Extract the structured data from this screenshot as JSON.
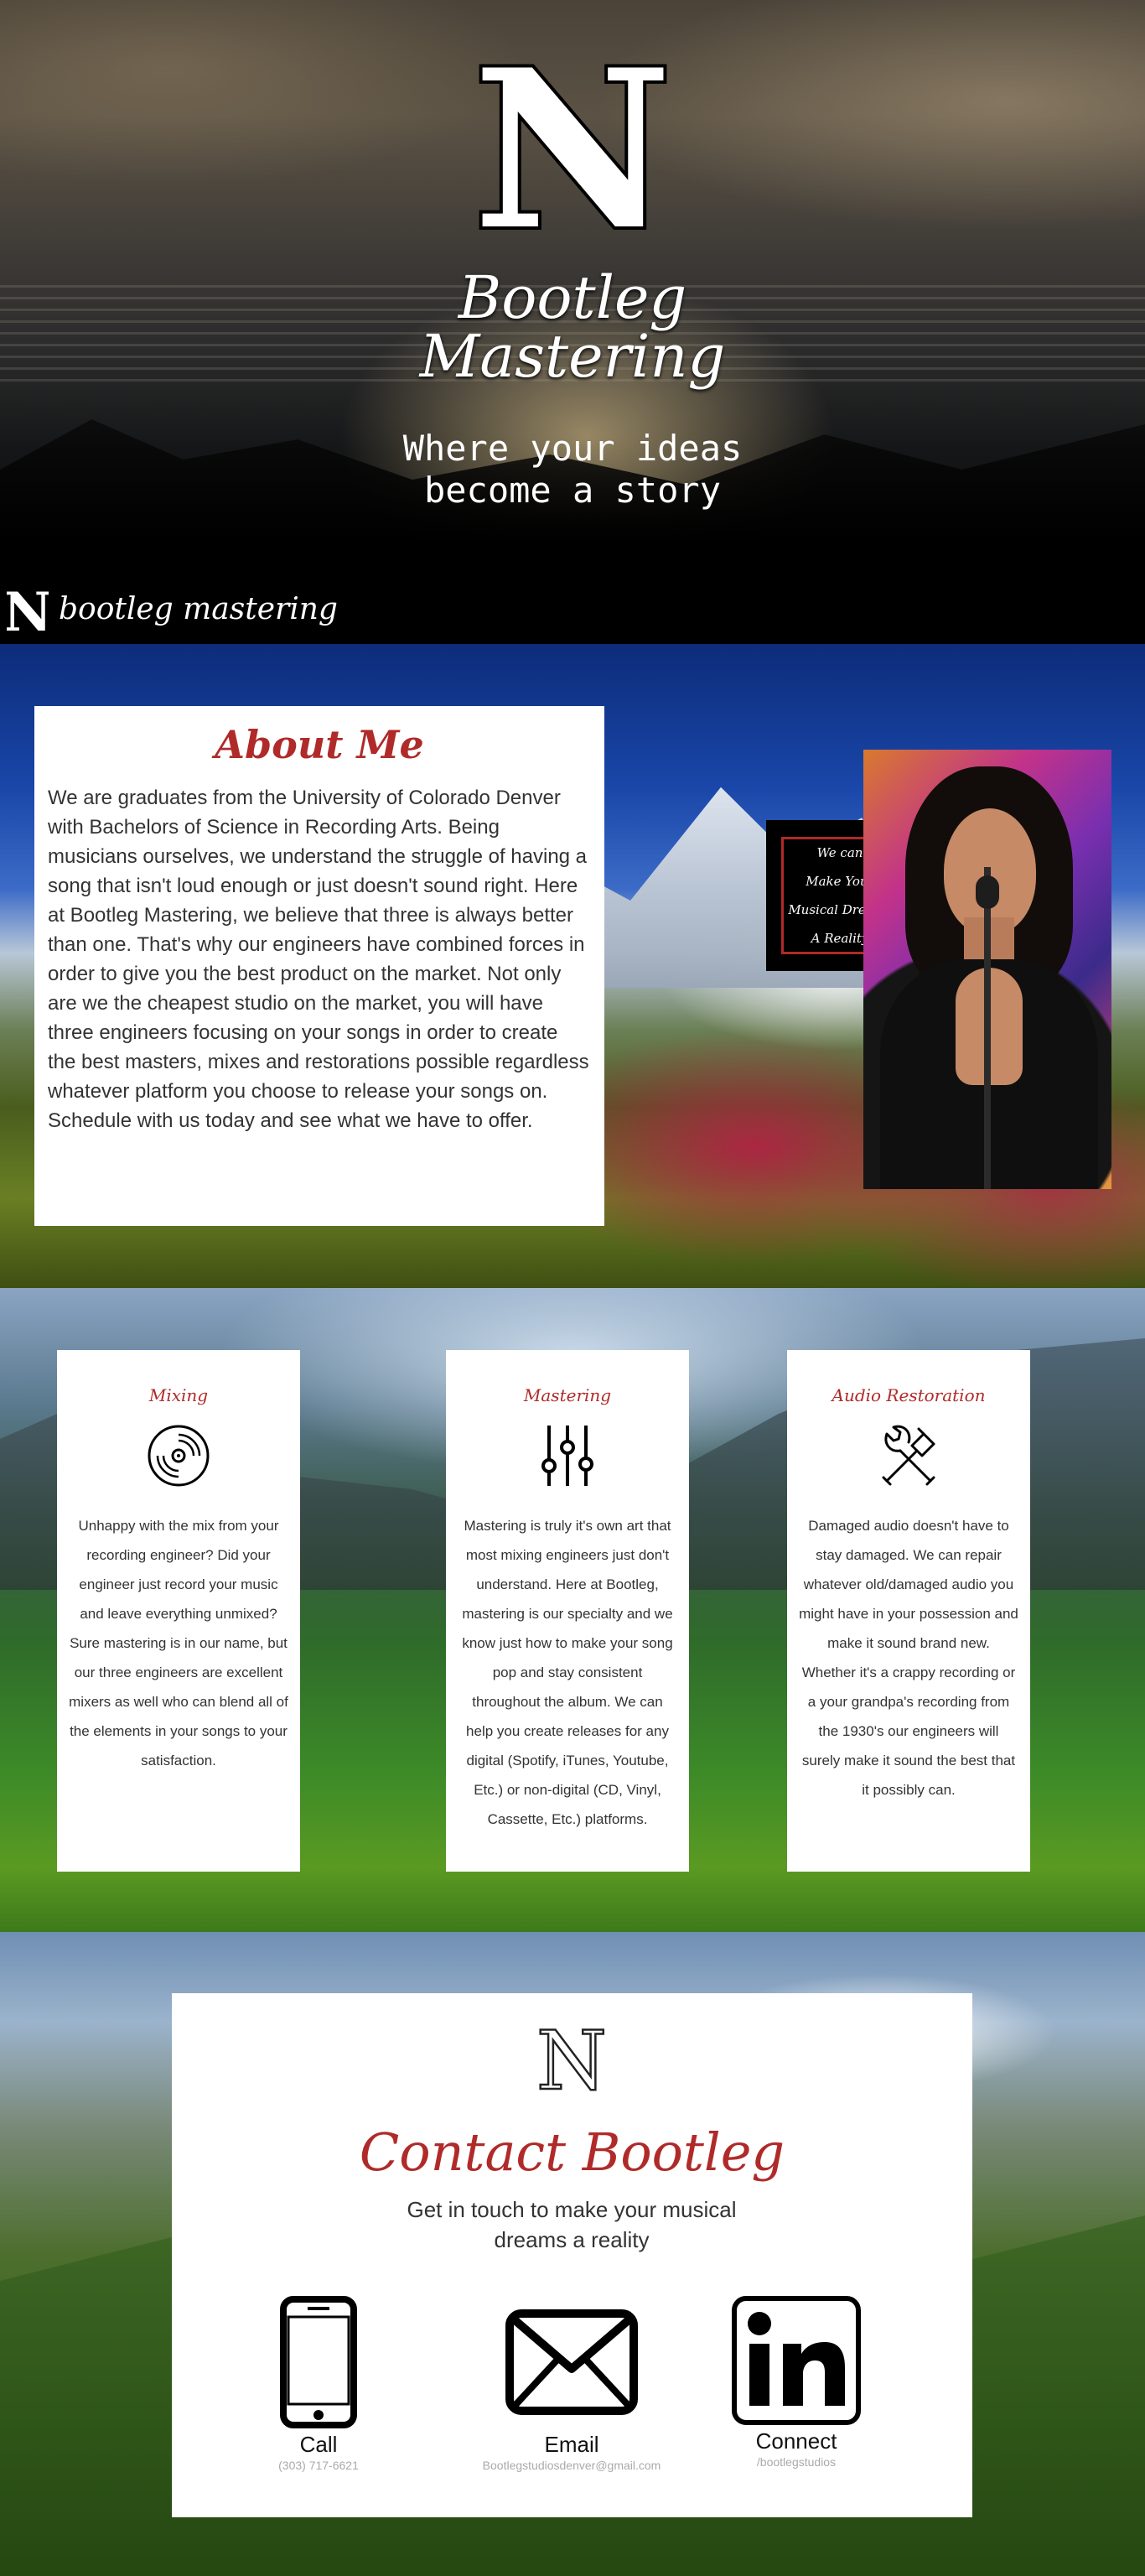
{
  "hero": {
    "logo_letter": "N",
    "title_line1": "Bootleg",
    "title_line2": "Mastering",
    "tagline": "Where your ideas\nbecome a story"
  },
  "nav": {
    "brand_letter": "N",
    "brand_text": "bootleg mastering"
  },
  "about": {
    "heading": "About Me",
    "body": "We are graduates from the University of Colorado Denver with Bachelors of Science in Recording Arts. Being musicians ourselves, we understand the struggle of having a song that isn't loud enough or just doesn't sound right. Here at Bootleg Mastering, we believe that three is always better than one. That's why our engineers have combined forces in order to give you the best product on the market. Not only are we the cheapest studio on the market, you will have three engineers focusing on your songs in order to create the best masters, mixes and restorations possible regardless whatever platform you choose to release your songs on. Schedule with us today and see what we have to offer.",
    "quote": "We can\nMake Your\nMusical Dreams\nA Reality"
  },
  "services": [
    {
      "title": "Mixing",
      "icon": "vinyl-record-icon",
      "body": "Unhappy with the mix from your recording engineer? Did your engineer just record your music and leave everything unmixed? Sure mastering is in our name, but our three engineers are excellent mixers as well who can blend all of the elements in your songs to your satisfaction."
    },
    {
      "title": "Mastering",
      "icon": "equalizer-sliders-icon",
      "body": "Mastering is truly it's own art that most mixing engineers just don't understand. Here at Bootleg, mastering is our specialty and we know just how to make your song pop and stay consistent throughout the album. We can help you create releases for any digital (Spotify, iTunes, Youtube, Etc.) or non-digital (CD, Vinyl, Cassette, Etc.) platforms."
    },
    {
      "title": "Audio Restoration",
      "icon": "tools-icon",
      "body": "Damaged audio doesn't have to stay damaged. We can repair whatever old/damaged audio you might have in your possession and make it sound brand new. Whether it's a crappy recording or a your grandpa's recording from the 1930's our engineers will surely make it sound the best that it possibly can."
    }
  ],
  "contact": {
    "logo_letter": "N",
    "heading": "Contact Bootleg",
    "subheading": "Get in touch to make your musical dreams a reality",
    "items": [
      {
        "label": "Call",
        "detail": "(303) 717-6621",
        "icon": "phone-icon"
      },
      {
        "label": "Email",
        "detail": "Bootlegstudiosdenver@gmail.com",
        "icon": "envelope-icon"
      },
      {
        "label": "Connect",
        "detail": "/bootlegstudios",
        "icon": "linkedin-icon"
      }
    ]
  },
  "colors": {
    "accent": "#b02a2a",
    "card_bg": "#ffffff",
    "body_text": "#333333"
  }
}
